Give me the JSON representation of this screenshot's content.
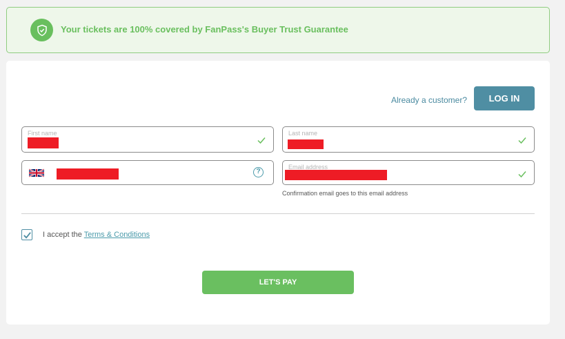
{
  "banner": {
    "text": "Your tickets are 100% covered by FanPass's Buyer Trust Guarantee",
    "icon": "shield-check-icon",
    "color": "#69bf5e"
  },
  "auth": {
    "prompt": "Already a customer?",
    "login_label": "LOG IN",
    "accent": "#4f8ea3"
  },
  "form": {
    "first_name": {
      "label": "First name",
      "valid": true
    },
    "last_name": {
      "label": "Last name",
      "valid": true
    },
    "phone": {
      "flag": "uk-flag-icon",
      "help_icon": "question-circle-icon",
      "help_glyph": "?"
    },
    "email": {
      "label": "Email address",
      "helper": "Confirmation email goes to this email address",
      "valid": true
    }
  },
  "terms": {
    "checked": true,
    "prefix": "I accept the",
    "link": "Terms & Conditions"
  },
  "pay": {
    "label": "LET'S PAY",
    "color": "#6abf60"
  }
}
